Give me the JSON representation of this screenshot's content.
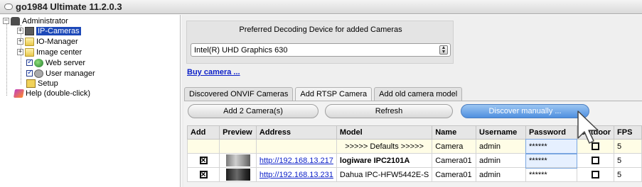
{
  "window": {
    "title": "go1984 Ultimate 11.2.0.3"
  },
  "tree": {
    "items": [
      {
        "label": "Administrator"
      },
      {
        "label": "IP-Cameras"
      },
      {
        "label": "IO-Manager"
      },
      {
        "label": "Image center"
      },
      {
        "label": "Web server"
      },
      {
        "label": "User manager"
      },
      {
        "label": "Setup"
      },
      {
        "label": "Help (double-click)"
      }
    ]
  },
  "decoding": {
    "label": "Preferred Decoding Device for added Cameras",
    "selected": "Intel(R) UHD Graphics 630"
  },
  "buy_link": "Buy camera ...",
  "tabs": [
    {
      "label": "Discovered ONVIF Cameras"
    },
    {
      "label": "Add RTSP Camera"
    },
    {
      "label": "Add old camera model"
    }
  ],
  "buttons": {
    "add": "Add 2 Camera(s)",
    "refresh": "Refresh",
    "discover": "Discover manually ..."
  },
  "table": {
    "columns": [
      "Add",
      "Preview",
      "Address",
      "Model",
      "Name",
      "Username",
      "Password",
      "Outdoor",
      "FPS"
    ],
    "defaults_row": {
      "model": ">>>>> Defaults >>>>>",
      "name": "Camera",
      "username": "admin",
      "password": "******",
      "fps": "5"
    },
    "rows": [
      {
        "address": "http://192.168.13.217",
        "model": "logiware IPC2101A",
        "name": "Camera01",
        "username": "admin",
        "password": "******",
        "fps": "5"
      },
      {
        "address": "http://192.168.13.231",
        "model": "Dahua IPC-HFW5442E-S",
        "name": "Camera01",
        "username": "admin",
        "password": "******",
        "fps": "5"
      }
    ]
  }
}
